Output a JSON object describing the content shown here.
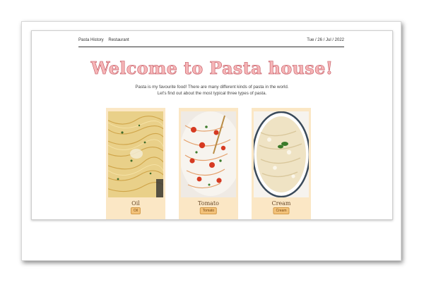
{
  "nav": {
    "links": [
      "Pasta History",
      "Restaurant"
    ],
    "date": "Tue / 26 / Jul / 2022"
  },
  "hero": {
    "title": "Welcome to Pasta house!",
    "intro_line1": "Pasta is my favourite food! There are many different kinds of pasta in the world.",
    "intro_line2": "Let's find out about the most typical three types of pasta."
  },
  "cards": [
    {
      "name": "Oil",
      "button": "Oil"
    },
    {
      "name": "Tomato",
      "button": "Tomato"
    },
    {
      "name": "Cream",
      "button": "Cream"
    }
  ],
  "colors": {
    "title_fill": "#f6b6b8",
    "title_stroke": "#c2555f",
    "card_bg": "#fbe7c5",
    "button_bg": "#f3c27a"
  }
}
